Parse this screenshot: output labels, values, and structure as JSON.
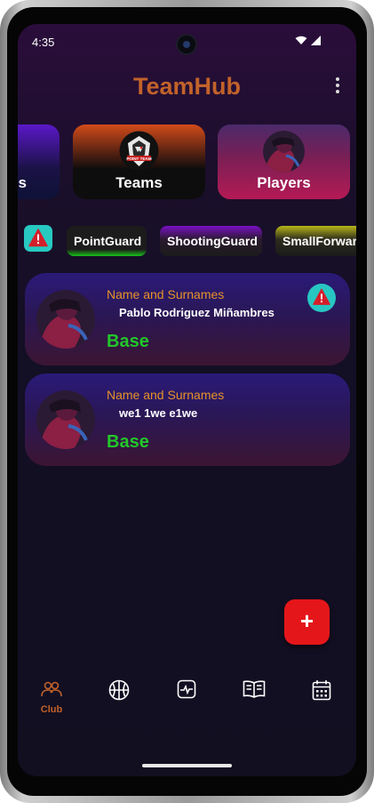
{
  "status_bar": {
    "time": "4:35",
    "icons": [
      "wifi-icon",
      "signal-icon"
    ]
  },
  "header": {
    "title": "TeamHub",
    "menu_icon": "more-vertical-icon"
  },
  "section_cards": [
    {
      "label": "s"
    },
    {
      "label": "Teams",
      "logo_text": "POINT TEAM"
    },
    {
      "label": "Players"
    }
  ],
  "position_filters": [
    "PointGuard",
    "ShootingGuard",
    "SmallForward"
  ],
  "players": [
    {
      "label": "Name and Surnames",
      "name": "Pablo Rodriguez Miñambres",
      "position": "Base",
      "warning": true
    },
    {
      "label": "Name and Surnames",
      "name": "we1 1we e1we",
      "position": "Base",
      "warning": false
    }
  ],
  "fab": {
    "label": "+"
  },
  "bottom_nav": [
    {
      "icon": "club-icon",
      "label": "Club",
      "active": true
    },
    {
      "icon": "basketball-icon",
      "label": ""
    },
    {
      "icon": "activity-icon",
      "label": ""
    },
    {
      "icon": "book-icon",
      "label": ""
    },
    {
      "icon": "calendar-icon",
      "label": ""
    }
  ],
  "colors": {
    "accent": "#c2622a",
    "position_text": "#22c72a",
    "label_text": "#e6922a",
    "fab": "#e5161a",
    "warning_badge": "#28c6c2",
    "warning_icon": "#d41f2a"
  }
}
